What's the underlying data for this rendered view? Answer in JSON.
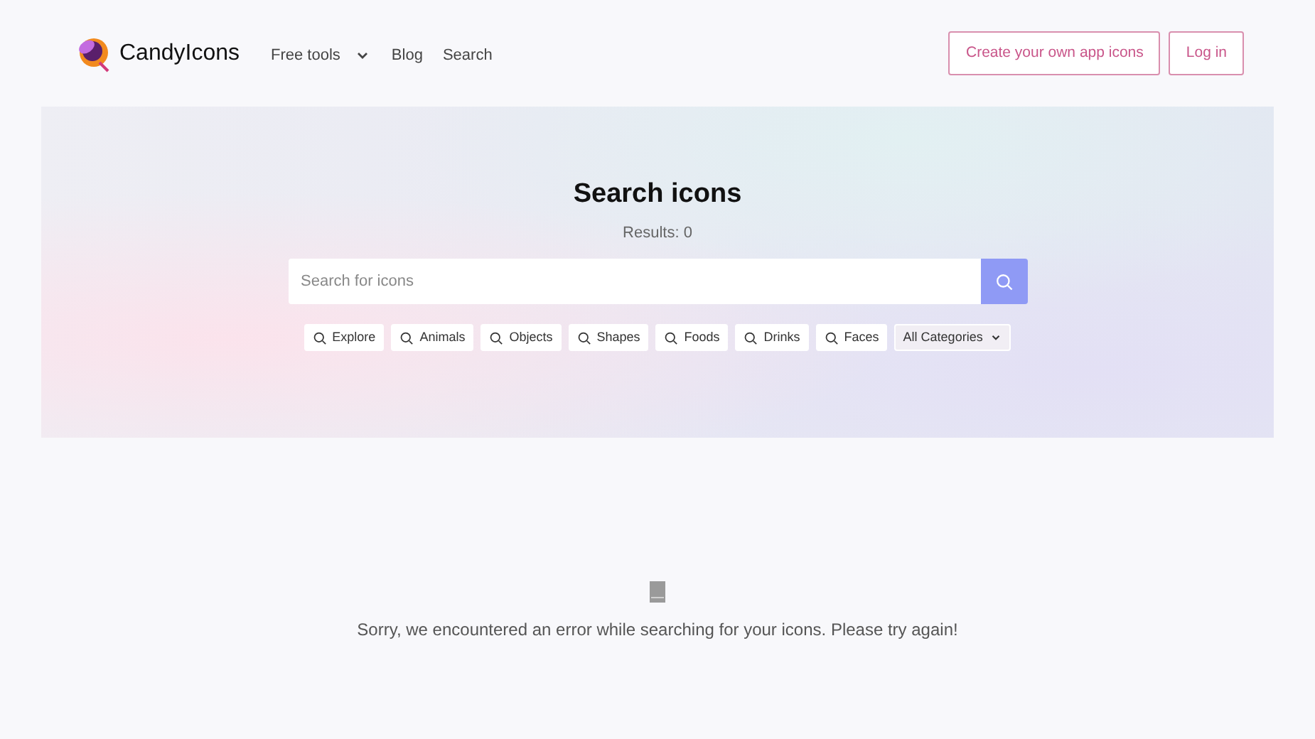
{
  "header": {
    "brand": "CandyIcons",
    "nav": [
      {
        "label": "Free tools",
        "kind": "dropdown"
      },
      {
        "label": "Blog",
        "kind": "link"
      },
      {
        "label": "Search",
        "kind": "link"
      }
    ],
    "buttons": [
      "Create your own app icons",
      "Log in"
    ]
  },
  "hero": {
    "title": "Search icons",
    "results": "Results: 0",
    "search": {
      "placeholder": "Search for icons"
    },
    "chips": [
      {
        "label": "Explore",
        "kind": "search"
      },
      {
        "label": "Animals",
        "kind": "search"
      },
      {
        "label": "Objects",
        "kind": "search"
      },
      {
        "label": "Shapes",
        "kind": "search"
      },
      {
        "label": "Foods",
        "kind": "search"
      },
      {
        "label": "Drinks",
        "kind": "search"
      },
      {
        "label": "Faces",
        "kind": "search"
      },
      {
        "label": "All Categories",
        "kind": "dropdown"
      }
    ]
  },
  "error": {
    "message": "Sorry, we encountered an error while searching for your icons. Please try again!"
  }
}
